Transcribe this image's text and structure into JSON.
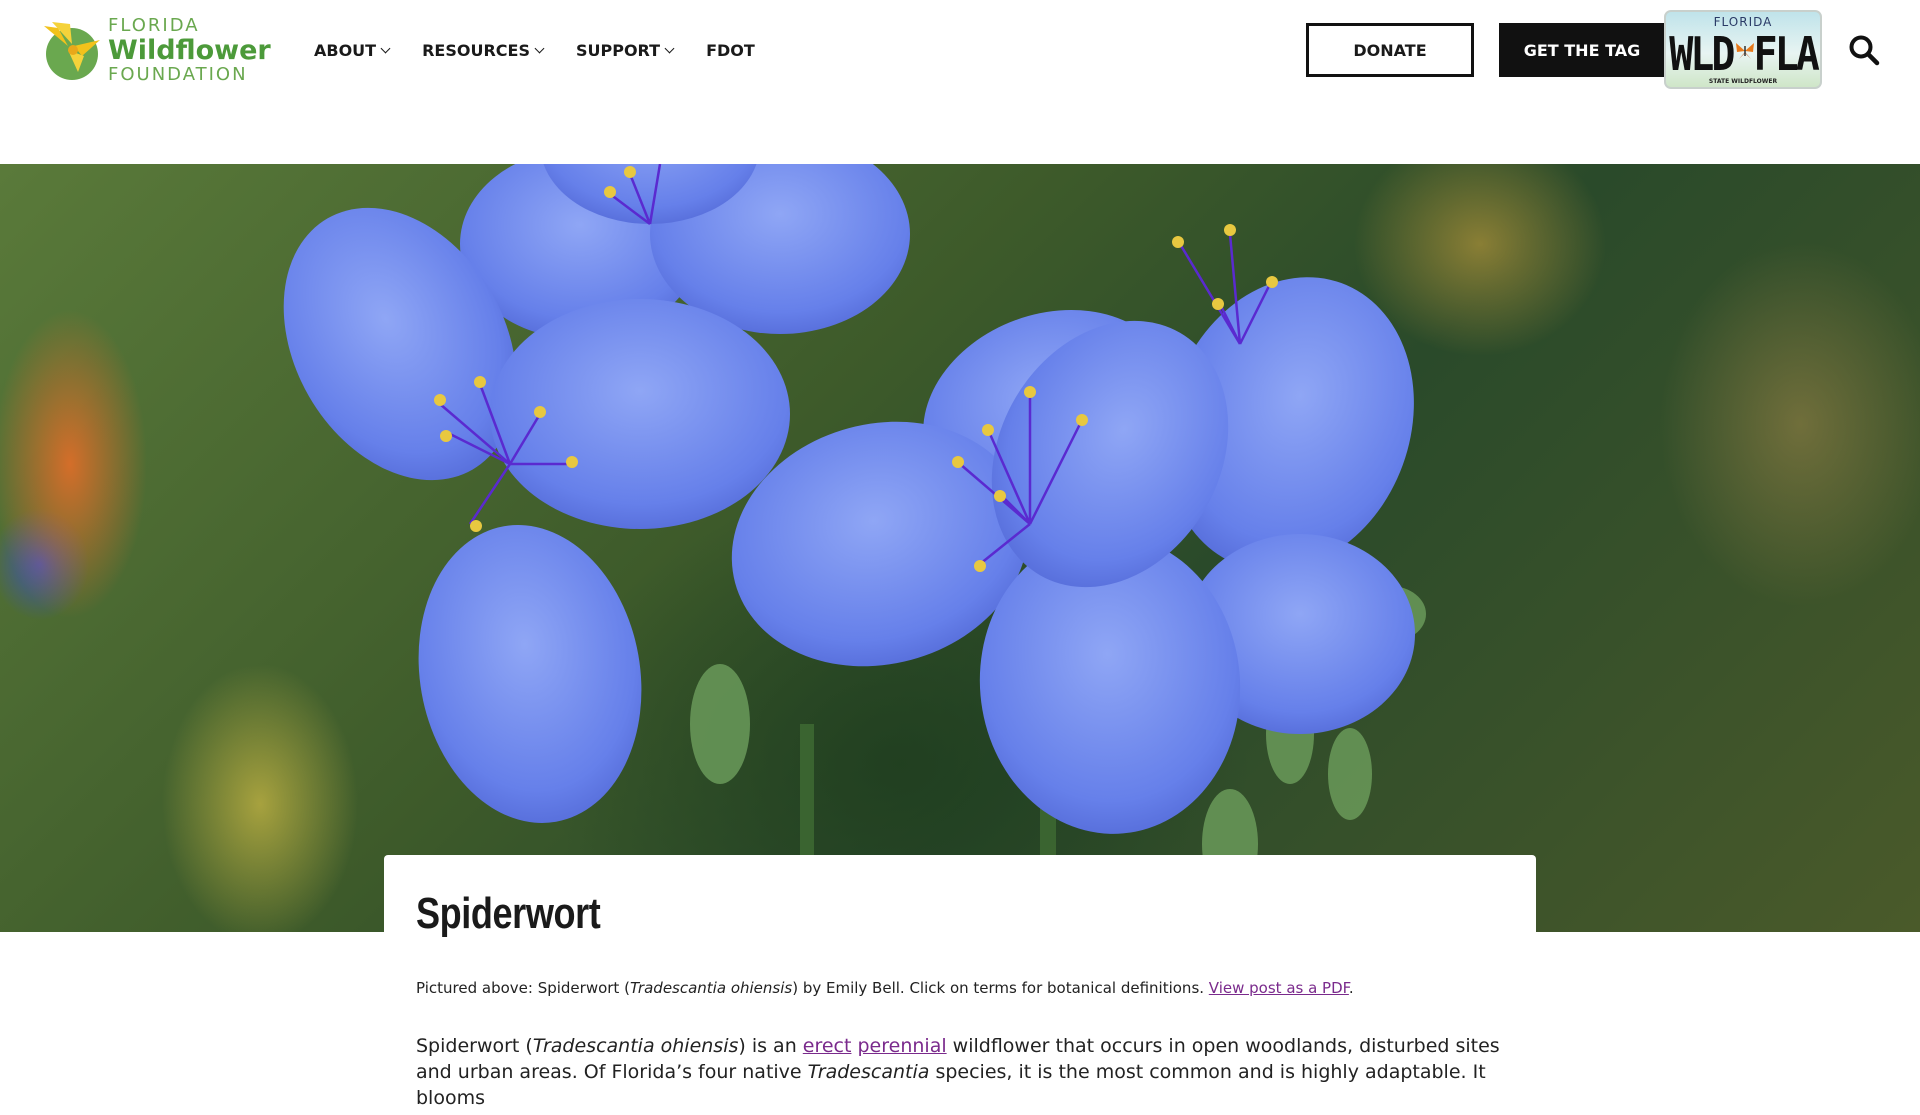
{
  "header": {
    "logo": {
      "line1": "FLORIDA",
      "line2": "Wildflower",
      "line3": "FOUNDATION"
    },
    "nav": [
      {
        "label": "ABOUT",
        "has_dropdown": true
      },
      {
        "label": "RESOURCES",
        "has_dropdown": true
      },
      {
        "label": "SUPPORT",
        "has_dropdown": true
      },
      {
        "label": "FDOT",
        "has_dropdown": false
      }
    ],
    "donate_label": "DONATE",
    "tag_label": "GET THE TAG",
    "plate": {
      "state": "FLORIDA",
      "number": "WLD FLA",
      "bottom": "STATE WILDFLOWER"
    },
    "icons": {
      "search": "search-icon",
      "chevron": "chevron-down-icon"
    }
  },
  "article": {
    "title": "Spiderwort",
    "caption": {
      "prefix": "Pictured above: Spiderwort (",
      "species": "Tradescantia ohiensis",
      "middle": ") by Emily Bell. Click on terms for botanical definitions. ",
      "pdf_link": "View post as a PDF",
      "suffix": "."
    },
    "intro": {
      "p1": "Spiderwort (",
      "species": "Tradescantia ohiensis",
      "p2": ") is an ",
      "link_erect": "erect",
      "link_perennial": "perennial",
      "p3": " wildflower that occurs in open woodlands, disturbed sites and urban areas. Of Florida’s four native ",
      "genus": "Tradescantia",
      "p4": " species, it is the most common and is highly adaptable. It blooms"
    }
  },
  "colors": {
    "link": "#7a2a8c",
    "brand_green": "#4c9a3a",
    "button_dark": "#111111"
  }
}
